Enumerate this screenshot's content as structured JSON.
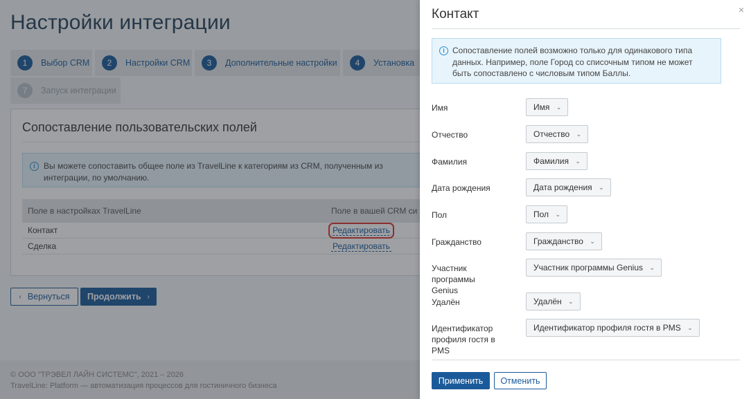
{
  "page": {
    "title": "Настройки интеграции",
    "steps": [
      {
        "num": "1",
        "label": "Выбор CRM"
      },
      {
        "num": "2",
        "label": "Настройки CRM"
      },
      {
        "num": "3",
        "label": "Дополнительные настройки"
      },
      {
        "num": "4",
        "label": "Установка"
      },
      {
        "num": "7",
        "label": "Запуск интеграции"
      }
    ],
    "card": {
      "title": "Сопоставление пользовательских полей",
      "info": "Вы можете сопоставить общее поле из TravelLine к категориям из CRM, полученным из интеграции, по умолчанию.",
      "columns": [
        "Поле в настройках TravelLine",
        "Поле в вашей CRM си"
      ],
      "rows": [
        {
          "field": "Контакт",
          "action": "Редактировать"
        },
        {
          "field": "Сделка",
          "action": "Редактировать"
        }
      ]
    },
    "back_label": "Вернуться",
    "next_label": "Продолжить",
    "footer_line1": "© ООО \"ТРЭВЕЛ ЛАЙН СИСТЕМС\", 2021 – 2026",
    "footer_line2": "TravelLine: Platform — автоматизация процессов для гостиничного бизнеса"
  },
  "drawer": {
    "title": "Контакт",
    "close_glyph": "×",
    "info": "Сопоставление полей возможно только для одинакового типа данных. Например, поле Город со списочным типом не может быть сопоставлено с числовым типом Баллы.",
    "fields": [
      {
        "label": "Имя",
        "value": "Имя"
      },
      {
        "label": "Отчество",
        "value": "Отчество"
      },
      {
        "label": "Фамилия",
        "value": "Фамилия"
      },
      {
        "label": "Дата рождения",
        "value": "Дата рождения"
      },
      {
        "label": "Пол",
        "value": "Пол"
      },
      {
        "label": "Гражданство",
        "value": "Гражданство"
      },
      {
        "label": "Участник программы Genius",
        "value": "Участник программы Genius"
      },
      {
        "label": "Удалён",
        "value": "Удалён"
      },
      {
        "label": "Идентификатор профиля гостя в PMS",
        "value": "Идентификатор профиля гостя в PMS"
      }
    ],
    "apply_label": "Применить",
    "cancel_label": "Отменить"
  }
}
